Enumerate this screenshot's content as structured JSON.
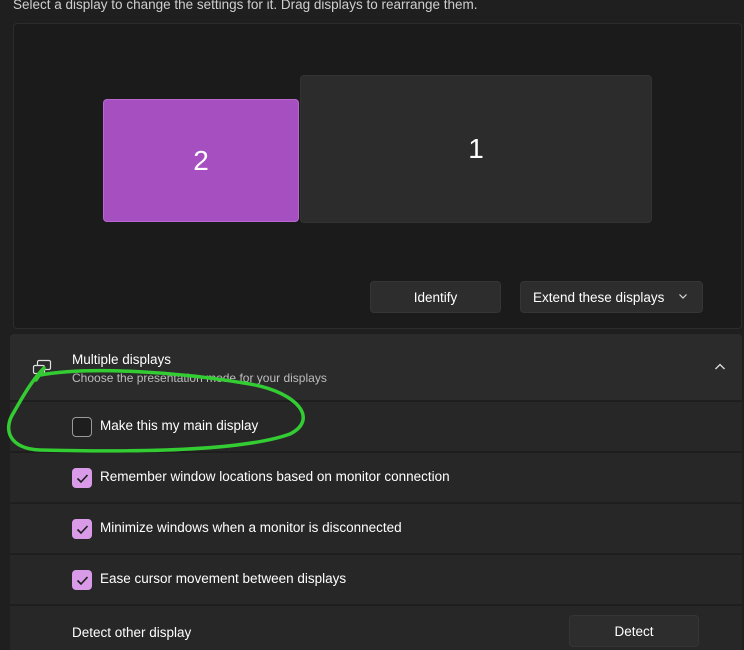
{
  "instruction": "Select a display to change the settings for it. Drag displays to rearrange them.",
  "displays": {
    "secondary_label": "2",
    "primary_label": "1",
    "selected_color": "#a64fc0"
  },
  "buttons": {
    "identify": "Identify",
    "extend": "Extend these displays",
    "detect": "Detect"
  },
  "multiple_displays": {
    "title": "Multiple displays",
    "subtitle": "Choose the presentation mode for your displays",
    "options": [
      {
        "label": "Make this my main display",
        "checked": false
      },
      {
        "label": "Remember window locations based on monitor connection",
        "checked": true
      },
      {
        "label": "Minimize windows when a monitor is disconnected",
        "checked": true
      },
      {
        "label": "Ease cursor movement between displays",
        "checked": true
      }
    ],
    "detect_label": "Detect other display"
  },
  "colors": {
    "accent": "#d99be8",
    "annotation": "#33cc33"
  },
  "icons": {
    "multi_display": "multiple-displays-icon",
    "collapse": "chevron-up-icon",
    "dropdown": "chevron-down-icon",
    "check": "checkmark-icon"
  }
}
